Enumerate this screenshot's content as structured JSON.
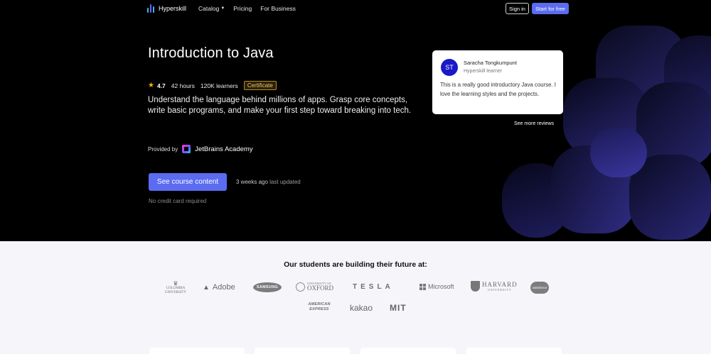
{
  "nav": {
    "brand": "Hyperskill",
    "links": [
      {
        "label": "Catalog",
        "has_dropdown": true
      },
      {
        "label": "Pricing"
      },
      {
        "label": "For Business"
      }
    ],
    "sign_in": "Sign in",
    "start": "Start for free"
  },
  "course": {
    "title": "Introduction to Java",
    "rating": "4.7",
    "hours": "42 hours",
    "learners": "120K learners",
    "badge": "Certificate",
    "description": "Understand the language behind millions of apps. Grasp core concepts, write basic programs, and make your first step toward breaking into tech.",
    "provided_label": "Provided by",
    "provider": "JetBrains Academy",
    "cta": "See course content",
    "updated_time": "3 weeks ago",
    "updated_suffix": "last updated",
    "note": "No credit card required"
  },
  "review": {
    "initials": "ST",
    "name": "Saracha Tongkumpunt",
    "role": "Hyperskill learner",
    "text": "This is a really good introductory Java course. I love the learning styles and the projects.",
    "see_more": "See more reviews"
  },
  "companies": {
    "title": "Our students are building their future at:",
    "columbia": {
      "line1": "COLUMBIA",
      "line2": "UNIVERSITY"
    },
    "adobe": "Adobe",
    "samsung": "SAMSUNG",
    "oxford": {
      "small": "UNIVERSITY OF",
      "name": "OXFORD"
    },
    "tesla": "TESLA",
    "microsoft": "Microsoft",
    "harvard": {
      "name": "HARVARD",
      "small": "UNIVERSITY"
    },
    "salesforce": "salesforce",
    "amex": {
      "line1": "AMERICAN",
      "line2": "EXPRESS"
    },
    "kakao": "kakao",
    "mit": "MIT"
  },
  "colors": {
    "accent": "#5b6cf0",
    "hero_bg": "#000000",
    "avatar": "#1a18c8",
    "certificate": "#f0c76a"
  }
}
